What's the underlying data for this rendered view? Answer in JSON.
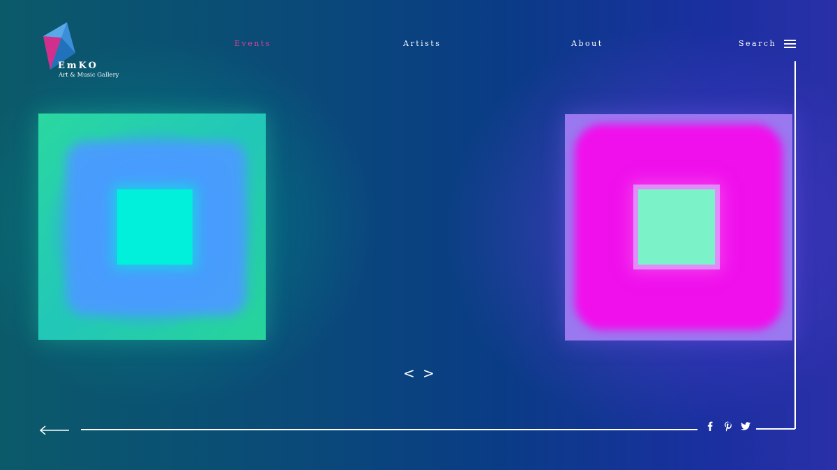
{
  "brand": {
    "name": "EmKO",
    "tagline": "Art & Music Gallery",
    "icon": "emko-logo-icon"
  },
  "nav": {
    "items": [
      {
        "label": "Events",
        "active": true
      },
      {
        "label": "Artists",
        "active": false
      },
      {
        "label": "About",
        "active": false
      }
    ],
    "search_label": "Search",
    "menu_icon": "hamburger-menu-icon"
  },
  "carousel": {
    "prev_label": "<",
    "next_label": ">"
  },
  "footer": {
    "back_icon": "arrow-left-icon",
    "social": [
      "facebook-icon",
      "pinterest-icon",
      "twitter-icon"
    ]
  },
  "colors": {
    "accent": "#e0409c",
    "text": "#ffffff",
    "logo_blue": "#3a8fd8",
    "logo_pink": "#d0308c"
  }
}
